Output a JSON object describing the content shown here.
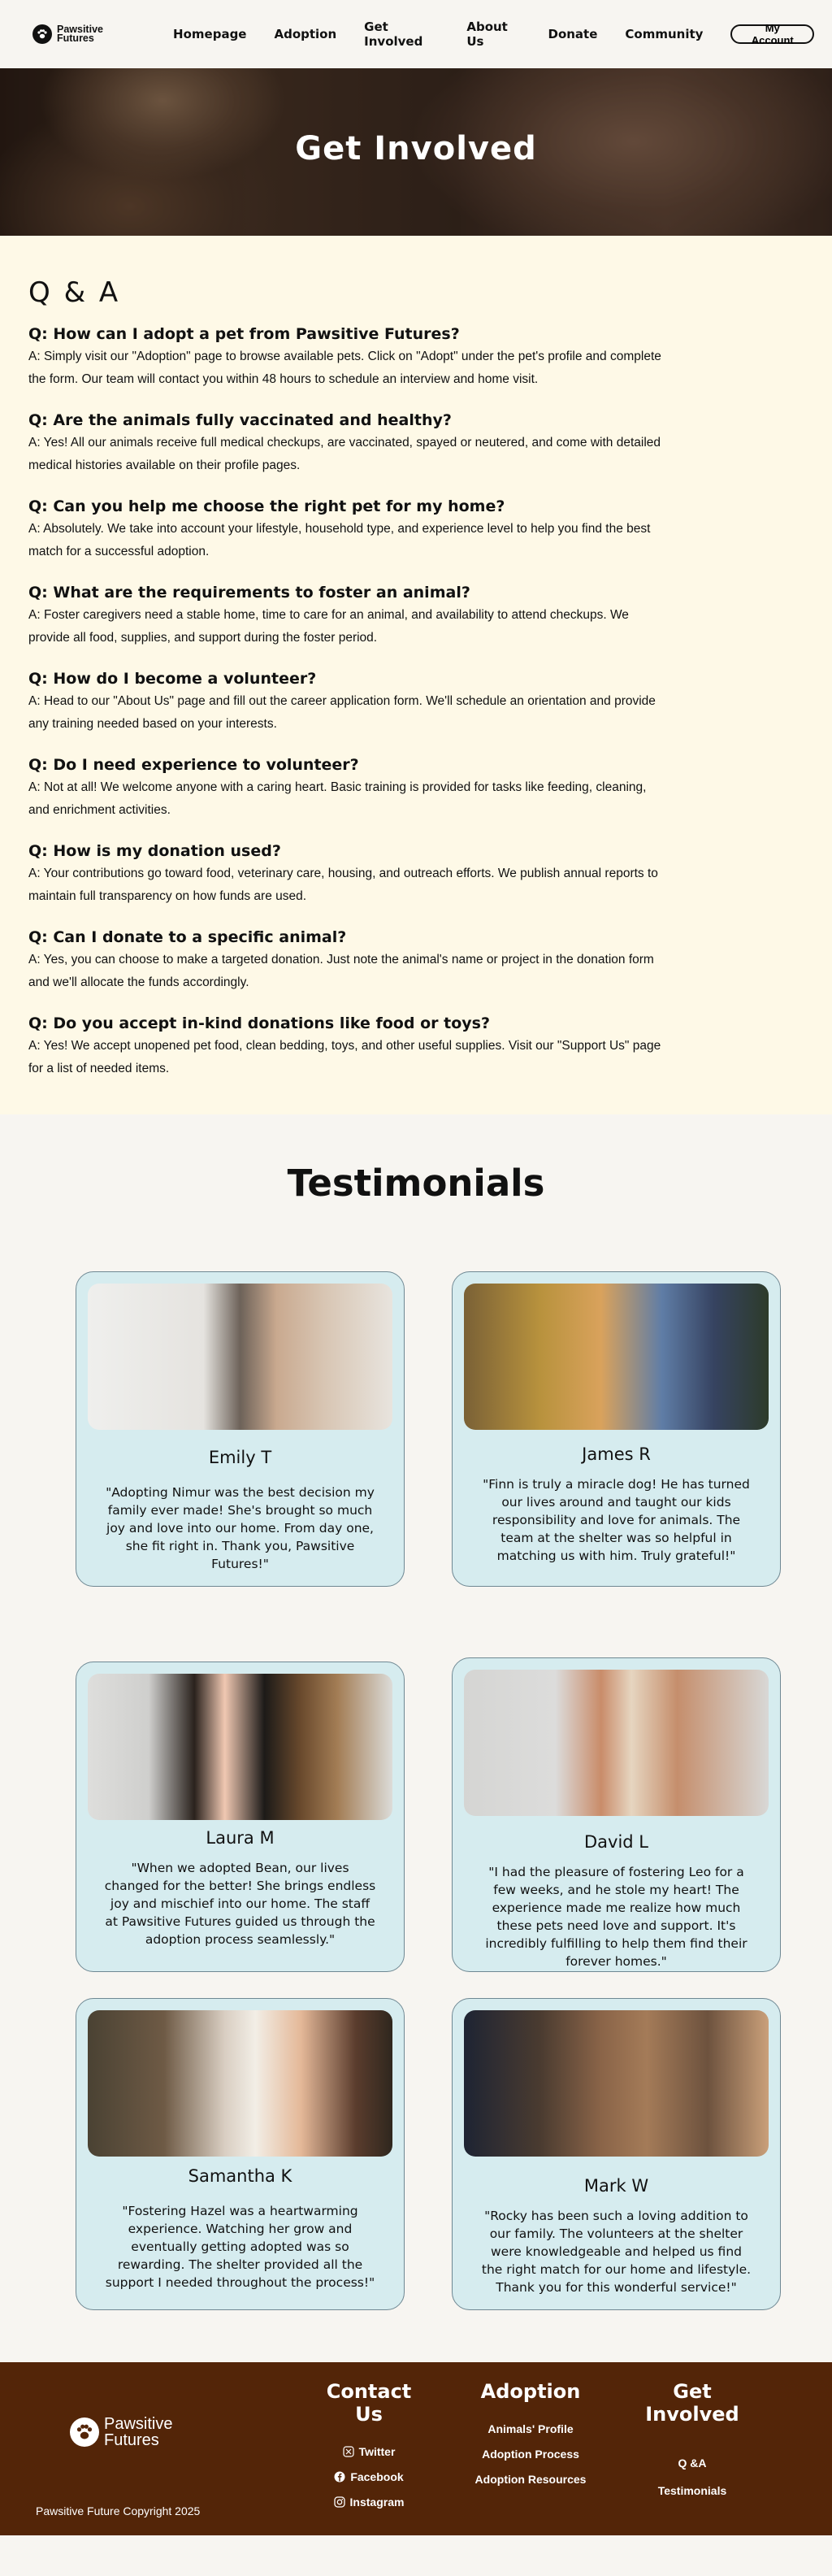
{
  "nav": {
    "logo_line1": "Pawsitive",
    "logo_line2": "Futures",
    "links": [
      "Homepage",
      "Adoption",
      "Get Involved",
      "About Us",
      "Donate",
      "Community"
    ],
    "account_label": "My Account"
  },
  "hero": {
    "title": "Get Involved"
  },
  "qa": {
    "heading": "Q & A",
    "items": [
      {
        "q": "Q: How can I adopt a pet from Pawsitive Futures?",
        "a": "A: Simply visit our \"Adoption\" page to browse available pets. Click on \"Adopt\" under the pet's profile and complete the form. Our team will contact you within 48 hours to schedule an interview and home visit."
      },
      {
        "q": "Q: Are the animals fully vaccinated and healthy?",
        "a": "A: Yes! All our animals receive full medical checkups, are vaccinated, spayed or neutered, and come with detailed medical histories available on their profile pages."
      },
      {
        "q": "Q: Can you help me choose the right pet for my home?",
        "a": "A: Absolutely. We take into account your lifestyle, household type, and experience level to help you find the best match for a successful adoption."
      },
      {
        "q": "Q: What are the requirements to foster an animal?",
        "a": "A: Foster caregivers need a stable home, time to care for an animal, and availability to attend checkups. We provide all food, supplies, and support during the foster period."
      },
      {
        "q": "Q: How do I become a volunteer?",
        "a": "A: Head to our \"About Us\" page and fill out the career application form. We'll schedule an orientation and provide any training needed based on your interests."
      },
      {
        "q": "Q: Do I need experience to volunteer?",
        "a": "A: Not at all! We welcome anyone with a caring heart. Basic training is provided for tasks like feeding, cleaning, and enrichment activities."
      },
      {
        "q": "Q: How is my donation used?",
        "a": "A: Your contributions go toward food, veterinary care, housing, and outreach efforts. We publish annual reports to maintain full transparency on how funds are used."
      },
      {
        "q": "Q: Can I donate to a specific animal?",
        "a": "A: Yes, you can choose to make a targeted donation. Just note the animal's name or project in the donation form and we'll allocate the funds accordingly."
      },
      {
        "q": "Q: Do you accept in-kind donations like food or toys?",
        "a": "A: Yes! We accept unopened pet food, clean bedding, toys, and other useful supplies. Visit our \"Support Us\" page for a list of needed items."
      }
    ]
  },
  "testimonials": {
    "heading": "Testimonials",
    "cards": [
      {
        "name": "Emily T",
        "quote": "\"Adopting Nimur was the best decision my family ever made! She's brought so much joy and love into our home. From day one, she fit right in. Thank you, Pawsitive Futures!\""
      },
      {
        "name": "James R",
        "quote": "\"Finn is truly a miracle dog! He has turned our lives around and taught our kids responsibility and love for animals. The team at the shelter was so helpful in matching us with him. Truly grateful!\""
      },
      {
        "name": "Laura M",
        "quote": "\"When we adopted Bean, our lives changed for the better! She brings endless joy and mischief into our home. The staff at Pawsitive Futures guided us through the adoption process seamlessly.\""
      },
      {
        "name": "David L",
        "quote": "\"I had the pleasure of fostering Leo for a few weeks, and he stole my heart! The experience made me realize how much these pets need love and support. It's incredibly fulfilling to help them find their forever homes.\""
      },
      {
        "name": "Samantha K",
        "quote": "\"Fostering Hazel was a heartwarming experience. Watching her grow and eventually getting adopted was so rewarding. The shelter provided all the support I needed throughout the process!\""
      },
      {
        "name": "Mark W",
        "quote": "\"Rocky has been such a loving addition to our family. The volunteers at the shelter were knowledgeable and helped us find the right match for our home and lifestyle. Thank you for this wonderful service!\""
      }
    ]
  },
  "footer": {
    "logo_line1": "Pawsitive",
    "logo_line2": "Futures",
    "copyright": "Pawsitive Future Copyright 2025",
    "contact": {
      "title": "Contact Us",
      "links": [
        "Twitter",
        "Facebook",
        "Instagram"
      ],
      "icons": [
        "twitter-icon",
        "facebook-icon",
        "instagram-icon"
      ]
    },
    "adoption": {
      "title": "Adoption",
      "links": [
        "Animals' Profile",
        "Adoption Process",
        "Adoption Resources"
      ]
    },
    "involved": {
      "title": "Get Involved",
      "links": [
        "Q &A",
        "Testimonials"
      ]
    }
  }
}
